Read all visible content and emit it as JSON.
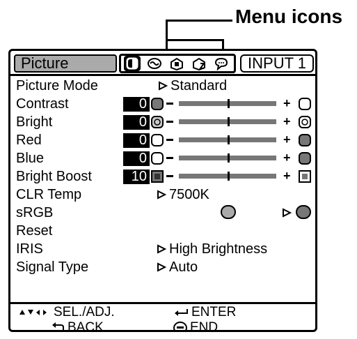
{
  "callout": {
    "label": "Menu icons"
  },
  "header": {
    "tab_label": "Picture",
    "input_label": "INPUT 1",
    "icons": [
      {
        "name": "picture-menu-icon",
        "selected": true
      },
      {
        "name": "audio-menu-icon",
        "selected": false
      },
      {
        "name": "options1-menu-icon",
        "selected": false
      },
      {
        "name": "options2-menu-icon",
        "selected": false
      },
      {
        "name": "language-menu-icon",
        "selected": false
      }
    ]
  },
  "rows": {
    "picture_mode": {
      "label": "Picture Mode",
      "value": "Standard"
    },
    "contrast": {
      "label": "Contrast",
      "value": "0",
      "level": 0.5
    },
    "bright": {
      "label": "Bright",
      "value": "0",
      "level": 0.5
    },
    "red": {
      "label": "Red",
      "value": "0",
      "level": 0.5
    },
    "blue": {
      "label": "Blue",
      "value": "0",
      "level": 0.5
    },
    "bright_boost": {
      "label": "Bright Boost",
      "value": "10",
      "level": 0.5
    },
    "clr_temp": {
      "label": "CLR Temp",
      "value": "7500K"
    },
    "srgb": {
      "label": "sRGB"
    },
    "reset": {
      "label": "Reset"
    },
    "iris": {
      "label": "IRIS",
      "value": "High Brightness"
    },
    "signal_type": {
      "label": "Signal Type",
      "value": "Auto"
    }
  },
  "footer": {
    "sel_adj": "SEL./ADJ.",
    "enter": "ENTER",
    "back": "BACK",
    "end": "END"
  },
  "colors": {
    "bar": "#777777",
    "tab_bg": "#aaaaaa",
    "value_bg": "#000000"
  }
}
